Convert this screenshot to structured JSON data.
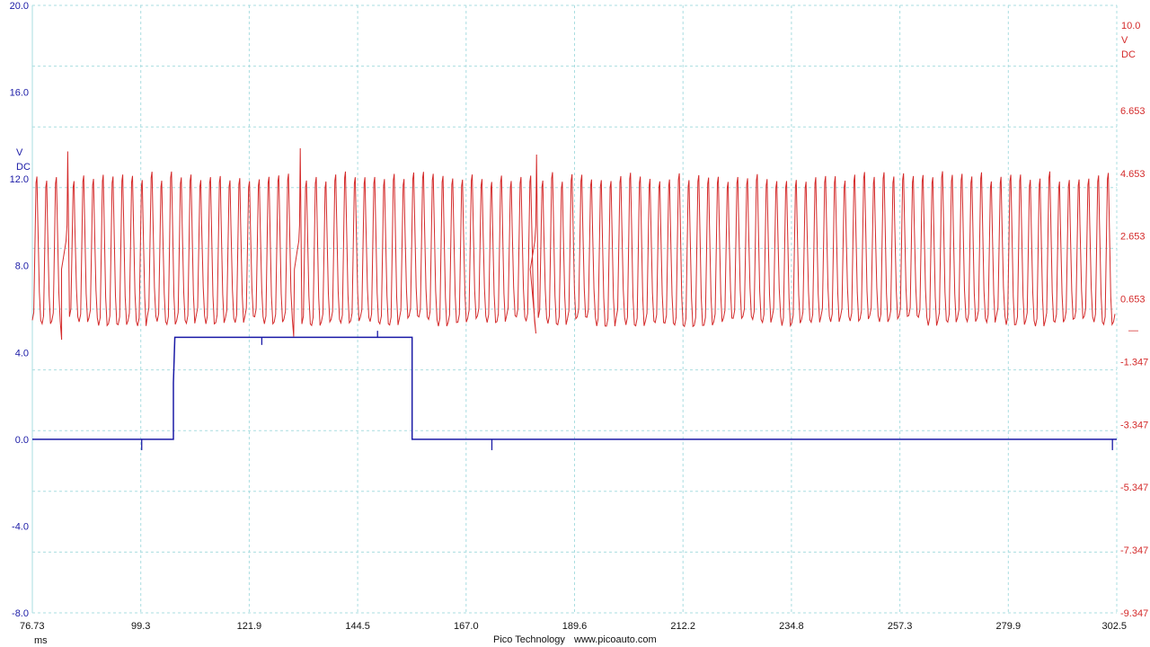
{
  "footer": {
    "brand": "Pico Technology",
    "url": "www.picoauto.com"
  },
  "chart_data": {
    "type": "line",
    "title": "",
    "grid": true,
    "xlabel": "ms",
    "xlim": [
      76.73,
      302.5
    ],
    "x_ticks": [
      "76.73",
      "99.3",
      "121.9",
      "144.5",
      "167.0",
      "189.6",
      "212.2",
      "234.8",
      "257.3",
      "279.9",
      "302.5"
    ],
    "left_axis": {
      "unit_line1": "V",
      "unit_line2": "DC",
      "color": "#1a1aa6",
      "ylim": [
        -8.0,
        20.0
      ],
      "ticks": [
        "20.0",
        "16.0",
        "12.0",
        "8.0",
        "4.0",
        "0.0",
        "-4.0",
        "-8.0"
      ]
    },
    "right_axis": {
      "unit_line0": "10.0",
      "unit_line1": "V",
      "unit_line2": "DC",
      "color": "#d42a2a",
      "ylim": [
        -9.347,
        10.0
      ],
      "ticks": [
        "6.653",
        "4.653",
        "2.653",
        "0.653",
        "-1.347",
        "-3.347",
        "-5.347",
        "-7.347",
        "-9.347"
      ],
      "zero_marker": "—"
    },
    "series": [
      {
        "axis": "right",
        "color": "#d42a2a",
        "kind": "oscillation",
        "period_ms": 2.03,
        "high_v": 4.55,
        "low_v": -0.05,
        "dropouts": [
          {
            "start_ms": 82.6,
            "end_ms": 84.3,
            "dip_v": -0.65,
            "spike_v": 5.35
          },
          {
            "start_ms": 131.1,
            "end_ms": 132.7,
            "dip_v": -0.55,
            "spike_v": 5.45
          },
          {
            "start_ms": 180.2,
            "end_ms": 181.9,
            "dip_v": -0.45,
            "spike_v": 5.25
          }
        ]
      },
      {
        "axis": "left",
        "color": "#1a1aa6",
        "kind": "pulse",
        "points": [
          [
            76.73,
            0.0
          ],
          [
            106.1,
            0.0
          ],
          [
            106.1,
            2.6
          ],
          [
            106.4,
            4.7
          ],
          [
            155.8,
            4.7
          ],
          [
            155.8,
            0.0
          ],
          [
            302.5,
            0.0
          ]
        ],
        "glitches": [
          [
            99.5,
            -0.5
          ],
          [
            124.5,
            -0.35
          ],
          [
            148.6,
            0.3
          ],
          [
            172.4,
            -0.5
          ],
          [
            301.6,
            -0.5
          ]
        ]
      }
    ]
  }
}
